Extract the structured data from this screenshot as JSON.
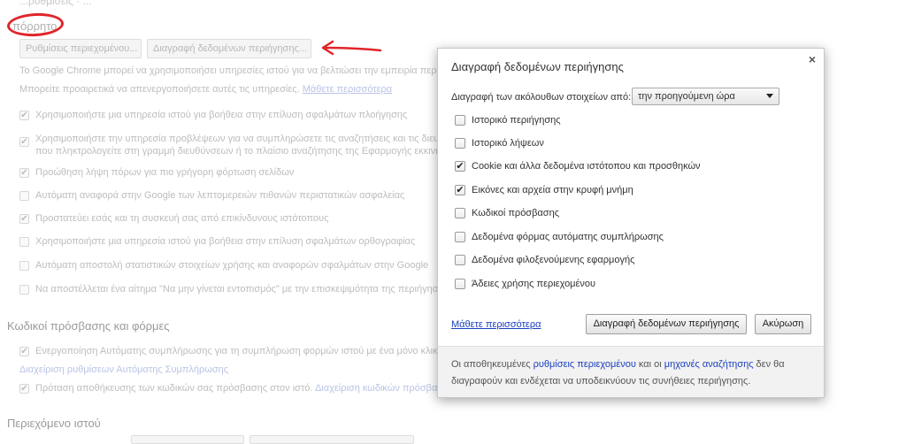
{
  "background": {
    "top_fragment": "...ρυθμίσεις · ...",
    "section_privacy_title": "πόρρητο",
    "btn_content_settings": "Ρυθμίσεις περιεχομένου...",
    "btn_clear_browsing": "Διαγραφή δεδομένων περιήγησης...",
    "intro_line1": "Το Google Chrome μπορεί να χρησιμοποιήσει υπηρεσίες ιστού για να βελτιώσει την εμπειρία περιήγ",
    "intro_line2": "Μπορείτε προαιρετικά να απενεργοποιήσετε αυτές τις υπηρεσίες.",
    "intro_link": "Μάθετε περισσότερα",
    "privacy_items": [
      {
        "label": "Χρησιμοποιήστε μια υπηρεσία ιστού για βοήθεια στην επίλυση σφαλμάτων πλοήγησης",
        "checked": true
      },
      {
        "label": "Χρησιμοποιήστε την υπηρεσία προβλέψεων για να συμπληρώσετε τις αναζητήσεις και τις διευθ",
        "checked": true
      },
      {
        "label": "Προώθηση λήψη πόρων για πιο γρήγορη φόρτωση σελίδων",
        "checked": true
      },
      {
        "label": "Αυτόματη αναφορά στην Google των λεπτομερειών πιθανών περιστατικών ασφαλείας",
        "checked": false
      },
      {
        "label": "Προστατεύει εσάς και τη συσκευή σας από επικίνδυνους ιστότοπους",
        "checked": true
      },
      {
        "label": "Χρησιμοποιήστε μια υπηρεσία ιστού για βοήθεια στην επίλυση σφαλμάτων ορθογραφίας",
        "checked": false
      },
      {
        "label": "Αυτόματη αποστολή στατιστικών στοιχείων χρήσης και αναφορών σφαλμάτων στην Google",
        "checked": false
      },
      {
        "label": "Να αποστέλλεται ένα αίτημα \"Να μην γίνεται εντοπισμός\" με την επισκεψιμότητα της περιήγησ",
        "checked": false
      }
    ],
    "privacy_item2_line2": "που πληκτρολογείτε στη γραμμή διευθύνσεων ή το πλαίσιο αναζήτησης της Εφαρμογής εκκινη",
    "passwords_title": "Κωδικοί πρόσβασης και φόρμες",
    "autofill_label": "Ενεργοποίηση Αυτόματης συμπλήρωσης για τη συμπλήρωση φορμών ιστού με ένα μόνο κλικ.",
    "autofill_link": "Διαχείριση ρυθμίσεων Αυτόματης Συμπλήρωσης",
    "save_passwords_label": "Πρόταση αποθήκευσης των κωδικών σας πρόσβασης στον ιστό.",
    "save_passwords_link": "Διαχείριση κωδικών πρόσβα",
    "web_content_title": "Περιεχόμενο ιστού"
  },
  "dialog": {
    "title": "Διαγραφή δεδομένων περιήγησης",
    "close_glyph": "×",
    "range_label": "Διαγραφή των ακόλουθων στοιχείων από:",
    "range_selected": "την προηγούμενη ώρα",
    "options": [
      {
        "label": "Ιστορικό περιήγησης",
        "checked": false
      },
      {
        "label": "Ιστορικό λήψεων",
        "checked": false
      },
      {
        "label": "Cookie και άλλα δεδομένα ιστότοπου και προσθηκών",
        "checked": true
      },
      {
        "label": "Εικόνες και αρχεία στην κρυφή μνήμη",
        "checked": true
      },
      {
        "label": "Κωδικοί πρόσβασης",
        "checked": false
      },
      {
        "label": "Δεδομένα φόρμας αυτόματης συμπλήρωσης",
        "checked": false
      },
      {
        "label": "Δεδομένα φιλοξενούμενης εφαρμογής",
        "checked": false
      },
      {
        "label": "Άδειες χρήσης περιεχομένου",
        "checked": false
      }
    ],
    "learn_more": "Μάθετε περισσότερα",
    "clear_button": "Διαγραφή δεδομένων περιήγησης",
    "cancel_button": "Ακύρωση",
    "footer": {
      "part1": "Οι αποθηκευμένες ",
      "link1": "ρυθμίσεις περιεχομένου",
      "part2": " και οι ",
      "link2": "μηχανές αναζήτησης",
      "part3": " δεν θα διαγραφούν και ενδέχεται να υποδεικνύουν τις συνήθειες περιήγησης."
    }
  },
  "check_glyph": "✔",
  "annotation_color": "#e0252a"
}
